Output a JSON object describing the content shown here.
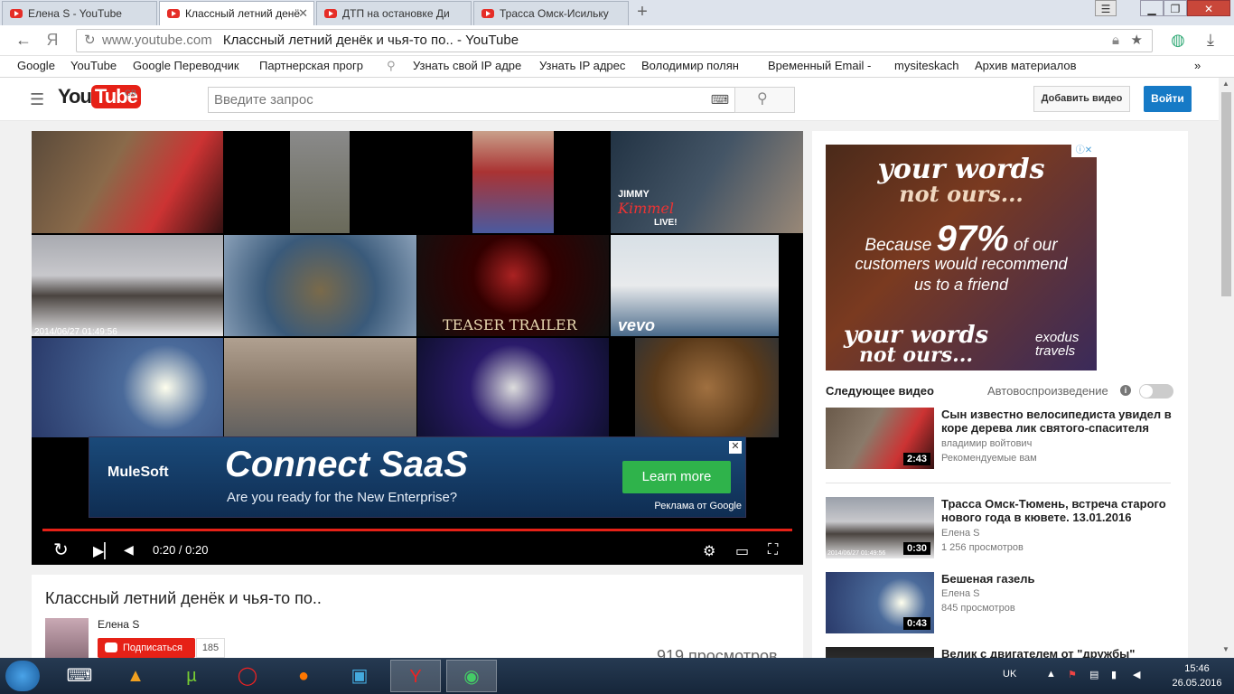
{
  "browser": {
    "tabs": [
      {
        "label": "Елена S - YouTube"
      },
      {
        "label": "Классный летний денё"
      },
      {
        "label": "ДТП на остановке Ди"
      },
      {
        "label": "Трасса Омск-Исильку"
      }
    ],
    "address": {
      "host": "www.youtube.com",
      "title": "Классный летний денёк и чья-то по.. - YouTube"
    },
    "bookmarks": [
      "Google",
      "YouTube",
      "Google Переводчик",
      "Партнерская прогр",
      "Узнать свой IP адре",
      "Узнать IP адрес",
      "Володимир полян",
      "Временный Email -",
      "mysiteskach",
      "Архив материалов"
    ],
    "bookmarks_more": "»"
  },
  "youtube": {
    "logo_you": "You",
    "logo_tube": "Tube",
    "region": "GB",
    "search_placeholder": "Введите запрос",
    "upload_label": "Добавить видео",
    "login_label": "Войти"
  },
  "player": {
    "timestamp_overlay": "2014/06/27  01:49:56",
    "endscreen_labels": {
      "trailer": "TEASER TRAILER",
      "vevo": "vevo",
      "jimmy": "JIMMY",
      "kimmel": "Kimmel",
      "live": "LIVE!"
    },
    "ad": {
      "brand": "MuleSoft",
      "headline": "Connect SaaS",
      "subline": "Are you ready for the New Enterprise?",
      "cta": "Learn more",
      "attribution": "Реклама от Google"
    },
    "time": "0:20 / 0:20",
    "progress_fraction": 1.0
  },
  "video": {
    "title": "Классный летний денёк и чья-то по..",
    "channel": "Елена S",
    "subscribe_label": "Подписаться",
    "subscriber_count": "185",
    "views": "919 просмотров"
  },
  "sidebar": {
    "ad_lines": [
      "your words",
      "not ours...",
      "Because",
      "97%",
      "of our",
      "customers would recommend",
      "us to a friend",
      "your words",
      "not ours...",
      "exodus",
      "travels"
    ],
    "up_next_label": "Следующее видео",
    "autoplay_label": "Автовоспроизведение",
    "recommendations": [
      {
        "title": "Сын известно велосипедиста увидел в коре дерева лик святого-спасителя",
        "line1": "владимир войтович",
        "line2": "Рекомендуемые вам",
        "duration": "2:43"
      },
      {
        "title": "Трасса Омск-Тюмень, встреча старого нового года в кювете. 13.01.2016",
        "line1": "Елена S",
        "line2": "1 256 просмотров",
        "duration": "0:30",
        "overlay": "2014/06/27  01:49:56"
      },
      {
        "title": "Бешеная газель",
        "line1": "Елена S",
        "line2": "845 просмотров",
        "duration": "0:43"
      },
      {
        "title": "Велик с двигателем от \"дружбы\"",
        "line1": "",
        "line2": "",
        "duration": ""
      }
    ]
  },
  "taskbar": {
    "lang": "UK",
    "time": "15:46",
    "date": "26.05.2016"
  }
}
